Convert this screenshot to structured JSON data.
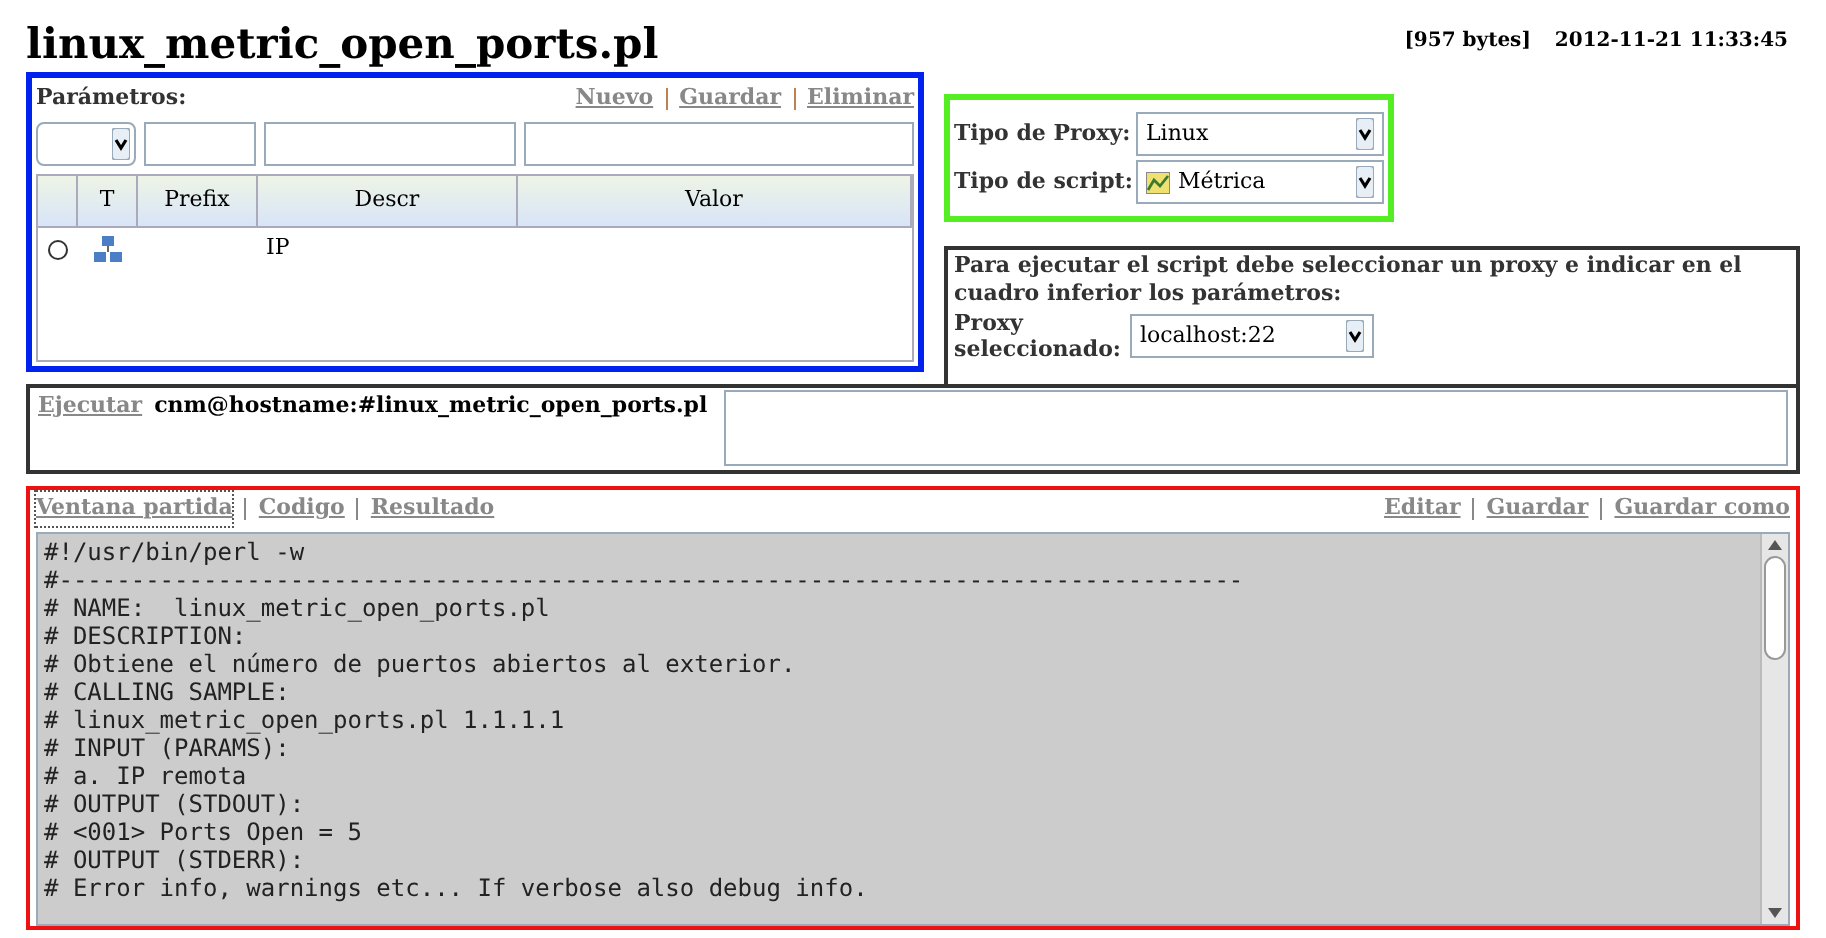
{
  "title": "linux_metric_open_ports.pl",
  "meta": {
    "size": "[957 bytes]",
    "date": "2012-11-21 11:33:45"
  },
  "parameters": {
    "label": "Parámetros:",
    "actions": [
      "Nuevo",
      "Guardar",
      "Eliminar"
    ],
    "columns": [
      "T",
      "Prefix",
      "Descr",
      "Valor"
    ],
    "rows": [
      {
        "selected": false,
        "descr": "IP"
      }
    ]
  },
  "proxy_panel": {
    "fields": [
      {
        "label": "Tipo de Proxy:",
        "value": "Linux",
        "kind": "plain"
      },
      {
        "label": "Tipo de script:",
        "value": "Métrica",
        "kind": "with_icon"
      }
    ]
  },
  "info": {
    "text": "Para ejecutar el script debe seleccionar un proxy e indicar en el cuadro inferior los parámetros:",
    "proxy_label": "Proxy seleccionado:",
    "proxy_value": "localhost:22"
  },
  "execute": {
    "link": "Ejecutar",
    "command": "cnm@hostname:#linux_metric_open_ports.pl"
  },
  "editor": {
    "views": [
      {
        "label": "Ventana partida",
        "selected": true
      },
      {
        "label": "Codigo",
        "selected": false
      },
      {
        "label": "Resultado",
        "selected": false
      }
    ],
    "actions": [
      "Editar",
      "Guardar",
      "Guardar como"
    ],
    "code_lines": [
      "#!/usr/bin/perl -w",
      "#----------------------------------------------------------------------------------",
      "# NAME:  linux_metric_open_ports.pl",
      "# DESCRIPTION:",
      "# Obtiene el número de puertos abiertos al exterior.",
      "# CALLING SAMPLE:",
      "# linux_metric_open_ports.pl 1.1.1.1",
      "# INPUT (PARAMS):",
      "# a. IP remota",
      "# OUTPUT (STDOUT):",
      "# <001> Ports Open = 5",
      "# OUTPUT (STDERR):",
      "# Error info, warnings etc... If verbose also debug info."
    ]
  }
}
